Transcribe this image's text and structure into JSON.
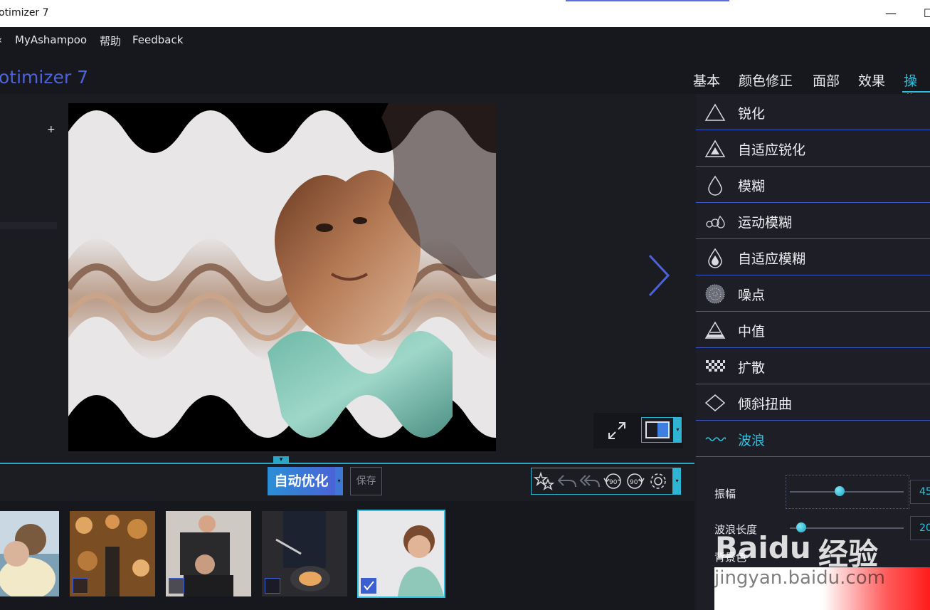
{
  "window": {
    "title": "otimizer 7",
    "minimize_glyph": "—",
    "maximize_glyph": "☐"
  },
  "menu": {
    "items": [
      {
        "label": "‹"
      },
      {
        "label": "MyAshampoo"
      },
      {
        "label": "帮助"
      },
      {
        "label": "Feedback"
      }
    ]
  },
  "header": {
    "app_name": "otimizer 7",
    "tabs": [
      {
        "label": "基本",
        "active": false
      },
      {
        "label": "颜色修正",
        "active": false
      },
      {
        "label": "面部",
        "active": false
      },
      {
        "label": "效果",
        "active": false
      },
      {
        "label": "操作",
        "active": true
      }
    ]
  },
  "left_panel": {
    "add_label": "+"
  },
  "toolbar": {
    "auto_optimize_label": "自动优化",
    "save_label": "保存",
    "dropdown_glyph": "▾"
  },
  "operations": [
    {
      "label": "锐化",
      "icon": "triangle-outline-icon",
      "active": false
    },
    {
      "label": "自适应锐化",
      "icon": "triangle-nested-icon",
      "active": false
    },
    {
      "label": "模糊",
      "icon": "droplet-outline-icon",
      "active": false
    },
    {
      "label": "运动模糊",
      "icon": "motion-drops-icon",
      "active": false
    },
    {
      "label": "自适应模糊",
      "icon": "droplet-filled-icon",
      "active": false
    },
    {
      "label": "噪点",
      "icon": "noise-sphere-icon",
      "active": false
    },
    {
      "label": "中值",
      "icon": "pyramid-icon",
      "active": false
    },
    {
      "label": "扩散",
      "icon": "checker-icon",
      "active": false
    },
    {
      "label": "倾斜扭曲",
      "icon": "diamond-icon",
      "active": false
    },
    {
      "label": "波浪",
      "icon": "wave-icon",
      "active": true
    }
  ],
  "wave_settings": {
    "amplitude": {
      "label": "振幅",
      "value": "45",
      "fraction": 0.44
    },
    "wavelength": {
      "label": "波浪长度",
      "value": "20",
      "fraction": 0.1
    },
    "color_label": "背景色"
  },
  "thumbnails": [
    {
      "name": "couple-photo",
      "selected": false,
      "checked": false
    },
    {
      "name": "shop-photo",
      "selected": false,
      "checked": false
    },
    {
      "name": "hairdresser-photo",
      "selected": false,
      "checked": false
    },
    {
      "name": "cooking-photo",
      "selected": false,
      "checked": false
    },
    {
      "name": "child-photo",
      "selected": true,
      "checked": true
    }
  ],
  "watermark": {
    "brand": "Baidu",
    "brand_suffix": "经验",
    "url": "jingyan.baidu.com"
  },
  "colors": {
    "accent": "#2ec1df",
    "brand_blue": "#4f63d8",
    "background": "#1b1c22"
  }
}
